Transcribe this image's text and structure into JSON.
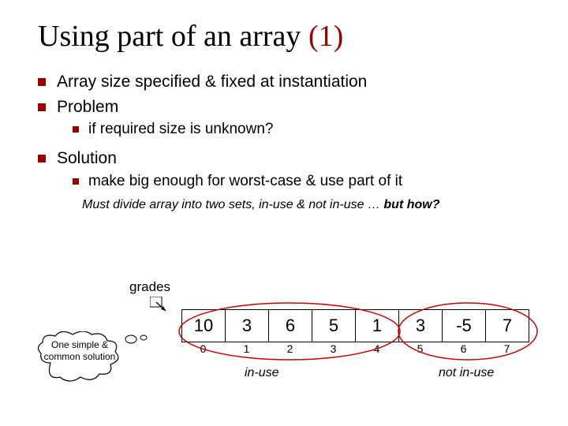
{
  "title": {
    "part1": "Using part of an array ",
    "part2": "(1)"
  },
  "bullets": {
    "b1": "Array size specified & fixed at instantiation",
    "b2": "Problem",
    "b2a": "if required size is unknown?",
    "b3": "Solution",
    "b3a": "make big enough for worst-case & use part of it"
  },
  "note": {
    "plain": "Must divide array into two sets, in-use & not in-use … ",
    "bold": "but how?"
  },
  "diagram": {
    "var_label": "grades",
    "cells": [
      "10",
      "3",
      "6",
      "5",
      "1",
      "3",
      "-5",
      "7"
    ],
    "indices": [
      "0",
      "1",
      "2",
      "3",
      "4",
      "5",
      "6",
      "7"
    ],
    "inuse_label": "in-use",
    "notinuse_label": "not in-use",
    "cloud_text": "One simple & common solution"
  }
}
